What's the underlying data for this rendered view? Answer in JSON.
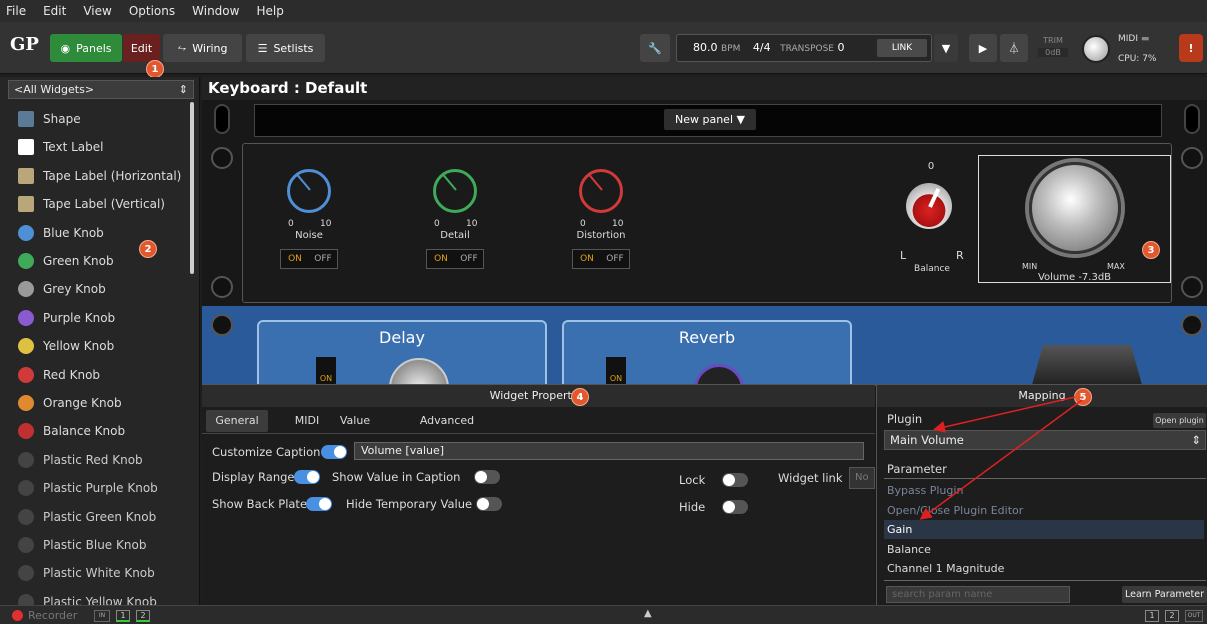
{
  "menu": [
    "File",
    "Edit",
    "View",
    "Options",
    "Window",
    "Help"
  ],
  "toolbar": {
    "panels_label": "Panels",
    "edit_label": "Edit",
    "wiring_label": "Wiring",
    "setlists_label": "Setlists",
    "bpm": "80.0",
    "bpm_unit": "BPM",
    "time_sig": "4/4",
    "transpose_label": "TRANSPOSE",
    "transpose_value": "0",
    "link_label": "LINK",
    "trim_label": "TRIM",
    "trim_value": "0dB",
    "midi_label": "MIDI",
    "cpu_label": "CPU: 7%"
  },
  "badges": {
    "b1": "1",
    "b2": "2",
    "b3": "3",
    "b4": "4",
    "b5": "5"
  },
  "sidebar": {
    "filter": "<All Widgets>",
    "items": [
      {
        "label": "Shape",
        "color": "#5a7a98"
      },
      {
        "label": "Text Label",
        "color": "#ffffff"
      },
      {
        "label": "Tape Label (Horizontal)",
        "color": "#b9a77a"
      },
      {
        "label": "Tape Label (Vertical)",
        "color": "#b9a77a"
      },
      {
        "label": "Blue Knob",
        "color": "#4e8fd6"
      },
      {
        "label": "Green Knob",
        "color": "#3faa5a"
      },
      {
        "label": "Grey Knob",
        "color": "#9a9a9a"
      },
      {
        "label": "Purple Knob",
        "color": "#8a5ad0"
      },
      {
        "label": "Yellow Knob",
        "color": "#e0c040"
      },
      {
        "label": "Red Knob",
        "color": "#d03a3a"
      },
      {
        "label": "Orange Knob",
        "color": "#e08a30"
      },
      {
        "label": "Balance Knob",
        "color": "#c03030"
      },
      {
        "label": "Plastic Red Knob",
        "color": "#444"
      },
      {
        "label": "Plastic Purple Knob",
        "color": "#444"
      },
      {
        "label": "Plastic Green Knob",
        "color": "#444"
      },
      {
        "label": "Plastic Blue Knob",
        "color": "#444"
      },
      {
        "label": "Plastic White Knob",
        "color": "#444"
      },
      {
        "label": "Plastic Yellow Knob",
        "color": "#444"
      }
    ]
  },
  "panel": {
    "title": "Keyboard : Default",
    "new_panel": "New panel",
    "knobs": [
      {
        "label": "Noise",
        "color": "#4e8fd6"
      },
      {
        "label": "Detail",
        "color": "#3faa5a"
      },
      {
        "label": "Distortion",
        "color": "#d03a3a"
      }
    ],
    "on": "ON",
    "off": "OFF",
    "scale_0": "0",
    "scale_10": "10",
    "balance_label": "Balance",
    "balance_zero": "0",
    "balance_l": "L",
    "balance_r": "R",
    "vol_min": "MIN",
    "vol_max": "MAX",
    "vol_caption": "Volume -7.3dB",
    "delay": "Delay",
    "reverb": "Reverb"
  },
  "props": {
    "title": "Widget Properties",
    "tabs": [
      "General",
      "MIDI",
      "Value",
      "Advanced"
    ],
    "customize_caption": "Customize Caption",
    "caption_value": "Volume [value]",
    "display_range": "Display Range",
    "show_value": "Show Value in Caption",
    "show_back": "Show Back Plate",
    "hide_temp": "Hide Temporary Value",
    "lock": "Lock",
    "hide": "Hide",
    "widget_link": "Widget link",
    "widget_link_value": "No"
  },
  "mapping": {
    "title": "Mapping",
    "plugin_label": "Plugin",
    "open_plugin": "Open plugin",
    "plugin_value": "Main Volume",
    "parameter_label": "Parameter",
    "params": [
      "Bypass Plugin",
      "Open/Close Plugin Editor",
      "Gain",
      "Balance",
      "Channel 1 Magnitude"
    ],
    "search_placeholder": "search param name",
    "learn": "Learn Parameter"
  },
  "status": {
    "recorder": "Recorder",
    "in": "IN",
    "out": "OUT",
    "n1": "1",
    "n2": "2"
  }
}
